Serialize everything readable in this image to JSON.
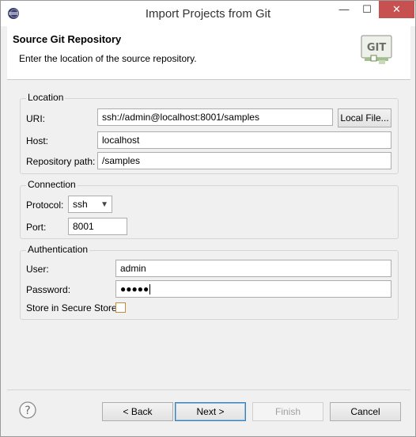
{
  "window": {
    "title": "Import Projects from Git",
    "controls": {
      "minimize": "—",
      "maximize": "☐",
      "close": "✕"
    }
  },
  "header": {
    "title": "Source Git Repository",
    "description": "Enter the location of the source repository.",
    "logo_text": "GIT"
  },
  "location": {
    "group_label": "Location",
    "uri_label": "URI:",
    "uri_value": "ssh://admin@localhost:8001/samples",
    "local_file_button": "Local File...",
    "host_label": "Host:",
    "host_value": "localhost",
    "repo_path_label": "Repository path:",
    "repo_path_value": "/samples"
  },
  "connection": {
    "group_label": "Connection",
    "protocol_label": "Protocol:",
    "protocol_value": "ssh",
    "port_label": "Port:",
    "port_value": "8001"
  },
  "authentication": {
    "group_label": "Authentication",
    "user_label": "User:",
    "user_value": "admin",
    "password_label": "Password:",
    "password_value": "●●●●●",
    "secure_store_label": "Store in Secure Store",
    "secure_store_checked": false
  },
  "footer": {
    "back": "< Back",
    "next": "Next >",
    "finish": "Finish",
    "cancel": "Cancel"
  },
  "icons": {
    "app": "eclipse-icon",
    "help": "help-icon",
    "logo": "git-logo"
  }
}
